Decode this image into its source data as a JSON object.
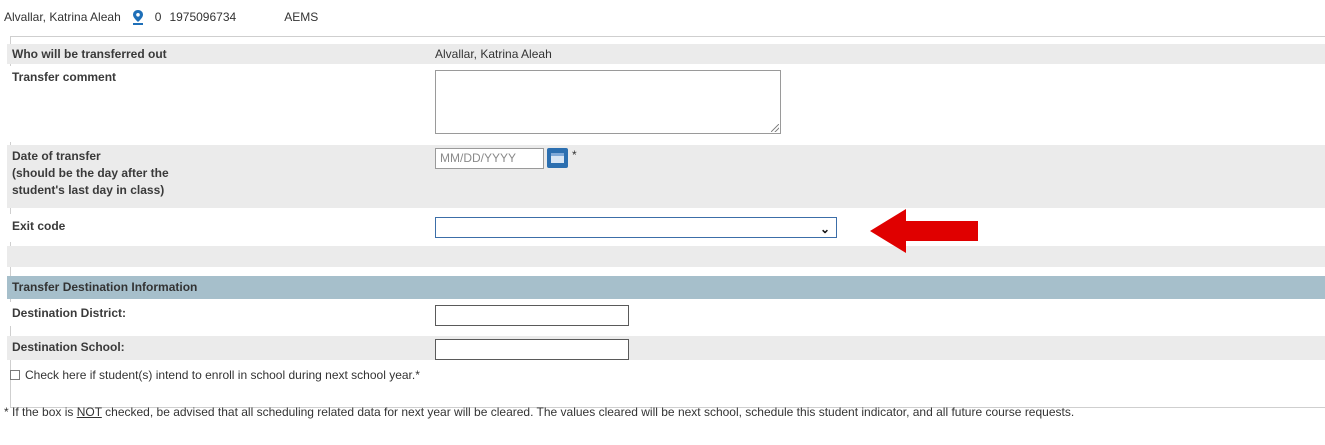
{
  "header": {
    "student_name": "Alvallar, Katrina Aleah",
    "count": "0",
    "student_id": "1975096734",
    "school": "AEMS"
  },
  "form": {
    "who_label": "Who will be transferred out",
    "who_value": "Alvallar, Katrina Aleah",
    "comment_label": "Transfer comment",
    "comment_value": "",
    "date_label_line1": "Date of transfer",
    "date_label_line2": "(should be the day after the",
    "date_label_line3": "student's last day in class)",
    "date_placeholder": "MM/DD/YYYY",
    "required_mark": "*",
    "exit_code_label": "Exit code",
    "exit_code_value": ""
  },
  "destination": {
    "section_title": "Transfer Destination Information",
    "district_label": "Destination District:",
    "district_value": "",
    "school_label": "Destination School:",
    "school_value": ""
  },
  "enroll_check": {
    "label": "Check here if student(s) intend to enroll in school during next school year.*",
    "checked": false
  },
  "note": {
    "prefix": "* If the box is ",
    "emphasis": "NOT",
    "suffix": " checked, be advised that all scheduling related data for next year will be cleared. The values cleared will be next school, schedule this student indicator, and all future course requests."
  },
  "icons": {
    "location": "location-pin-icon",
    "calendar": "calendar-icon",
    "dropdown": "chevron-down-icon",
    "annotation": "red-arrow-left"
  },
  "colors": {
    "section_header_bg": "#a6bfcb",
    "row_gray": "#ebebeb",
    "calendar_button": "#2c6fb0",
    "pin": "#1e6fb8",
    "arrow": "#e00000"
  }
}
